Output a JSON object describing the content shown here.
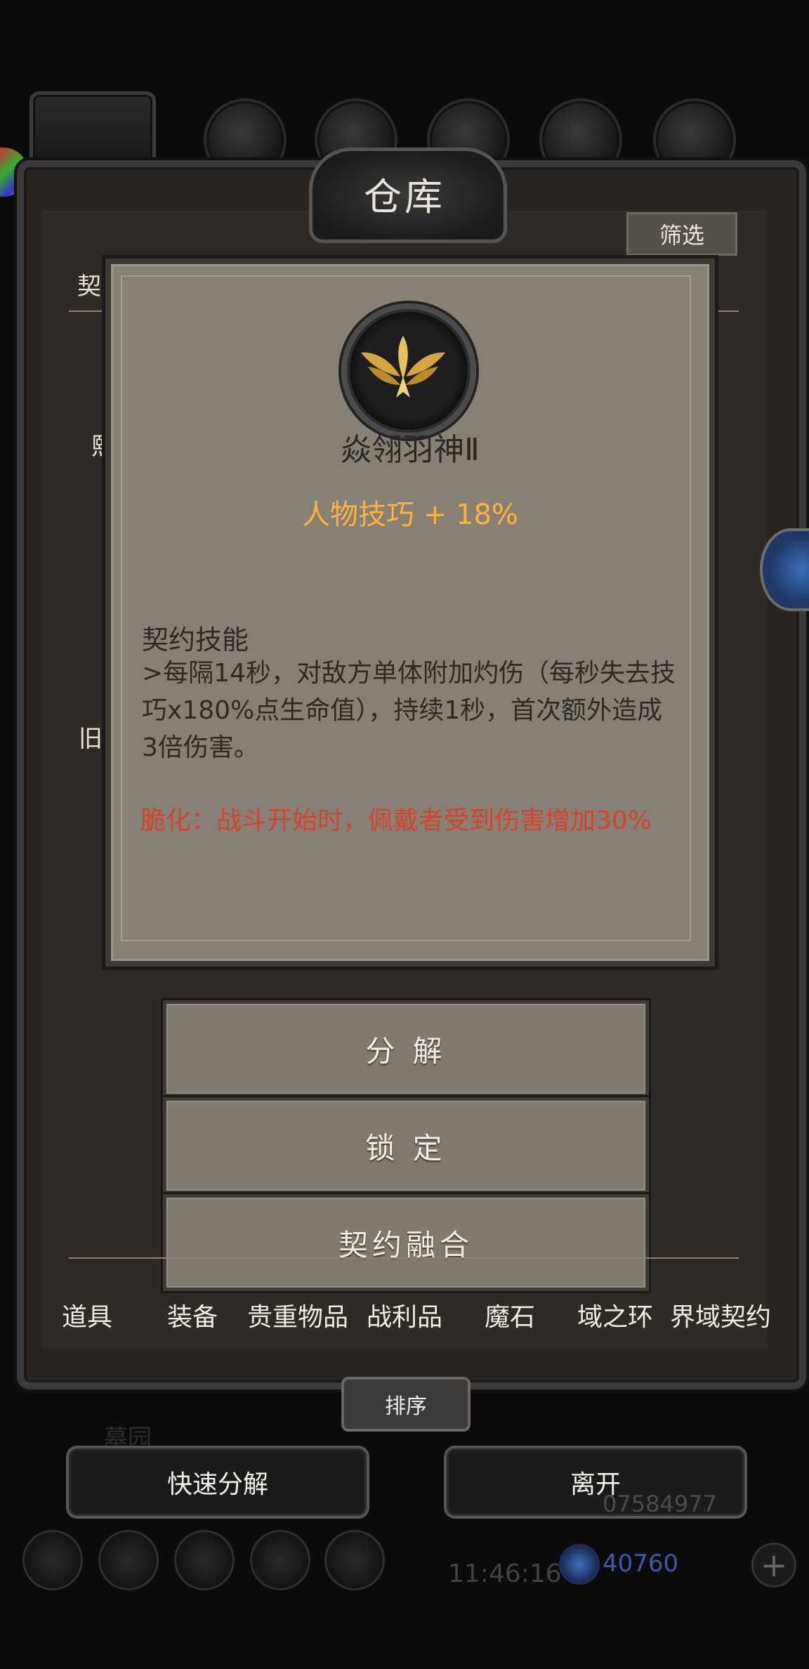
{
  "window": {
    "title": "仓库"
  },
  "toolbar": {
    "filter_label": "筛选"
  },
  "top_tabs": [
    {
      "icon": "demon-head-icon"
    },
    {
      "icon": "leather-armor-icon"
    },
    {
      "icon": "wood-plank-icon"
    },
    {
      "icon": "iron-plate-icon"
    },
    {
      "icon": "blue-feather-icon"
    },
    {
      "icon": "dark-shard-icon"
    }
  ],
  "background_list": {
    "header_left": "契",
    "item_1_label": "熙",
    "item_2_label": "旧",
    "right_cursor": "I"
  },
  "card": {
    "icon": "golden-phoenix-emblem-icon",
    "name": "焱翎羽神Ⅱ",
    "stat": "人物技巧 + 18%",
    "skill_heading": "契约技能",
    "skill_description": ">每隔14秒，对敌方单体附加灼伤（每秒失去技巧x180%点生命值），持续1秒，首次额外造成3倍伤害。",
    "warning": "脆化：战斗开始时，佩戴者受到伤害增加30%",
    "colors": {
      "stat": "#ffb23a",
      "warning": "#d7432d"
    }
  },
  "actions": {
    "decompose": "分 解",
    "lock": "锁 定",
    "fuse": "契约融合"
  },
  "categories": [
    "道具",
    "装备",
    "贵重物品",
    "战利品",
    "魔石",
    "域之环",
    "界域契约"
  ],
  "sort_label": "排序",
  "bottom": {
    "quick_decompose": "快速分解",
    "leave": "离开",
    "area_label": "墓园",
    "clock": "11:46:16",
    "gold_amount": "07584977",
    "gem_amount": "40760"
  },
  "menu_icons": [
    "settings-gear-icon",
    "star-badge-icon",
    "guild-crest-icon",
    "mail-icon",
    "handshake-icon"
  ]
}
